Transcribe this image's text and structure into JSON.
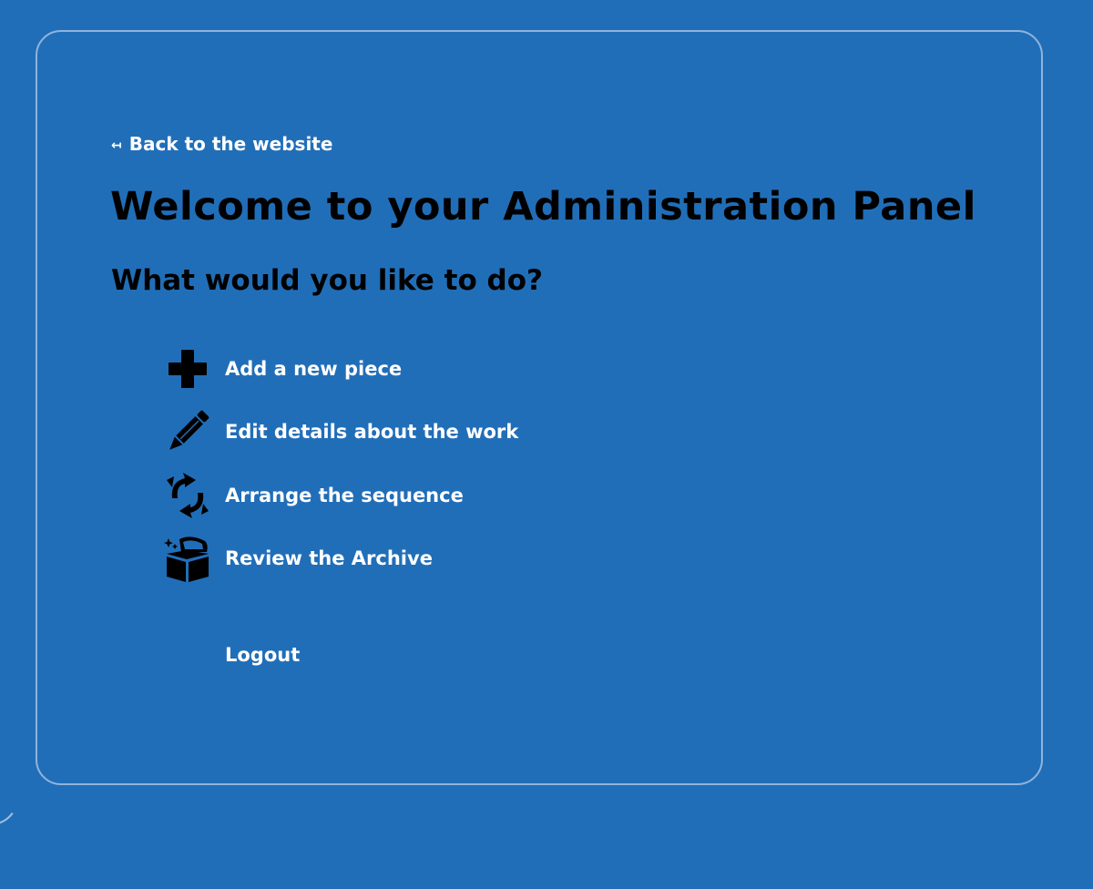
{
  "nav": {
    "back_label": "Back to the website",
    "back_arrow": "↤"
  },
  "header": {
    "title": "Welcome to your Administration Panel",
    "subtitle": "What would you like to do?"
  },
  "menu": {
    "items": [
      {
        "label": "Add a new piece",
        "icon": "plus-icon"
      },
      {
        "label": "Edit details about the work",
        "icon": "pencil-icon"
      },
      {
        "label": "Arrange the sequence",
        "icon": "rotate-arrows-icon"
      },
      {
        "label": "Review the Archive",
        "icon": "treasure-chest-icon"
      }
    ]
  },
  "account": {
    "logout_label": "Logout"
  },
  "colors": {
    "background": "#216eb8",
    "panel_border": "#8fb4dd",
    "heading_text": "#000000",
    "link_text": "#ffffff"
  }
}
